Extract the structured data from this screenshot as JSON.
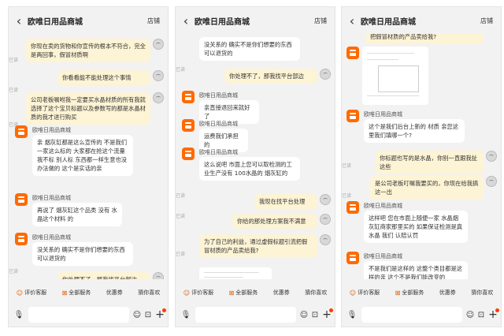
{
  "app": {
    "shop_name": "欧唯日用品商城",
    "store_label": "店铺"
  },
  "common": {
    "read_label": "已读",
    "quick_actions": [
      "评价客服",
      "全部服务",
      "优惠券",
      "猜你喜欢"
    ]
  },
  "phone1": {
    "messages": [
      {
        "role": "user",
        "text": "你现在卖的货物和你宣传的根本不符合，完全是两回事，假冒材质啊"
      },
      {
        "role": "user",
        "text": "你看看能不能处理这个事情"
      },
      {
        "role": "user",
        "text": "公司老板嘱咐我一定要买水晶材质的所有我就选择了这个宝贝标题以及参数写的都是水晶材质的我才进行购买"
      },
      {
        "role": "shop",
        "text": "亲  烟灰缸都是这么宣传的  不是我们一家这么标的  大家都在抢这个流量  我不标  别人标  东西都一样生意也没办法做的    这个是实话的亲"
      },
      {
        "role": "shop",
        "text": "再说了   烟灰缸这个品类  没有   水晶这个材料 的"
      },
      {
        "role": "shop",
        "text": "没关系的     确实不是你们想要的东西  可以退货的"
      },
      {
        "role": "user",
        "text": "你处理不了，那我找平台部边"
      }
    ]
  },
  "phone2": {
    "messages": [
      {
        "role": "shop",
        "text": "没关系的     确实不是你们想要的东西  可以退货的"
      },
      {
        "role": "user",
        "text": "你处理不了，那我找平台部边"
      },
      {
        "role": "shop",
        "text": "亲直接退回来就好了"
      },
      {
        "role": "shop",
        "text": "运费我们承担的"
      },
      {
        "role": "shop",
        "text": "这么说吧    市面上您可以取检测的工业生产没有 100水晶的 烟灰缸的"
      },
      {
        "role": "user",
        "text": "我现在找平台处理"
      },
      {
        "role": "user",
        "text": "你给的那处理方案我不满意"
      },
      {
        "role": "user",
        "text": "为了自己的利益，通过虚假标题引流把假冒材质的产品卖给我?"
      }
    ]
  },
  "phone3": {
    "messages": [
      {
        "role": "user",
        "text": "把假冒材质的产品卖给我?"
      },
      {
        "role": "shop",
        "text": "这个是我们后台上新的   材质   亲您这里我们填哪一个?"
      },
      {
        "role": "user",
        "text": "你标题也写的是水晶，你别一直跟我扯这些"
      },
      {
        "role": "user",
        "text": "是公司老板叮嘱我要买的，你现在给我搞这一出"
      },
      {
        "role": "shop",
        "text": "这样吧  您在市面上随便一家  水晶烟灰缸商家那里买的      如果保证检测是真水晶 我们 认赔认罚"
      },
      {
        "role": "shop",
        "text": "不是我们是这样的  这整个类目都是这样的亲   这个不是我们能改变的"
      }
    ]
  }
}
